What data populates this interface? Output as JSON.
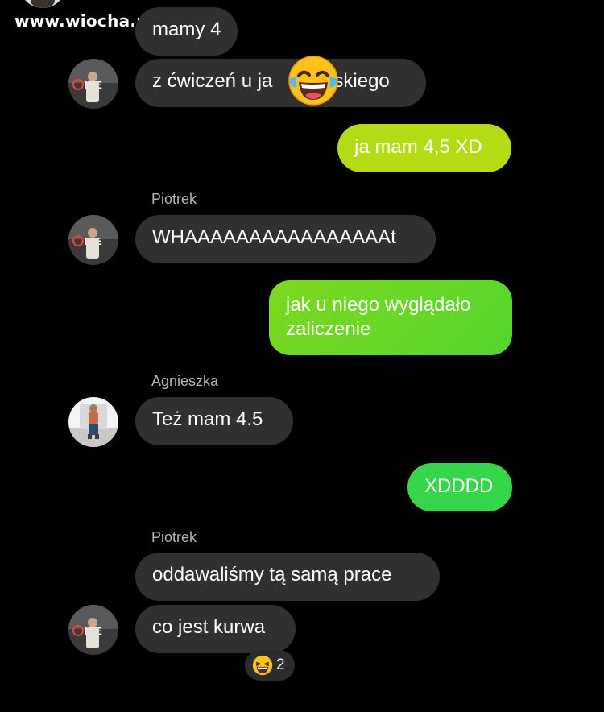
{
  "watermark": "www.wiocha.pl",
  "colors": {
    "incoming_bubble": "#303030",
    "outgoing_gradient": [
      "#c6e10e",
      "#38d84a"
    ],
    "background": "#000000"
  },
  "messages": [
    {
      "sender": "",
      "text": "mamy 4",
      "direction": "incoming"
    },
    {
      "sender": "",
      "text": "z ćwiczeń u ja",
      "text_after_emoji": "vskiego",
      "direction": "incoming",
      "overlay_icon": "face-with-tears-of-joy-icon"
    },
    {
      "sender": "",
      "text": "ja mam 4,5 XD",
      "direction": "outgoing"
    },
    {
      "sender": "Piotrek",
      "text": "WHAAAAAAAAAAAAAAAAt",
      "direction": "incoming"
    },
    {
      "sender": "",
      "text": "jak u niego wyglądało zaliczenie",
      "direction": "outgoing"
    },
    {
      "sender": "Agnieszka",
      "text": "Też mam 4.5",
      "direction": "incoming"
    },
    {
      "sender": "",
      "text": "XDDDD",
      "direction": "outgoing"
    },
    {
      "sender": "Piotrek",
      "text": "oddawaliśmy tą samą prace",
      "direction": "incoming"
    },
    {
      "sender": "",
      "text": "co jest kurwa",
      "direction": "incoming"
    }
  ],
  "reaction": {
    "icon": "grinning-squinting-face-icon",
    "count": "2"
  }
}
